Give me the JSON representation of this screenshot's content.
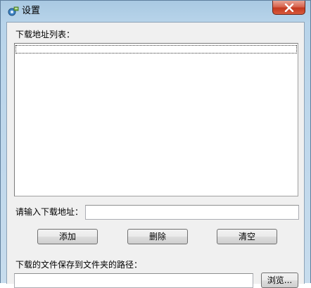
{
  "window": {
    "title": "设置",
    "icon": "settings-app-icon",
    "close_icon": "close-icon"
  },
  "list": {
    "label": "下载地址列表：",
    "items": []
  },
  "url_input": {
    "label": "请输入下载地址：",
    "value": "",
    "placeholder": ""
  },
  "buttons": {
    "add": "添加",
    "delete": "删除",
    "clear": "清空"
  },
  "save_path": {
    "label": "下载的文件保存到文件夹的路径：",
    "value": "",
    "browse": "浏览..."
  },
  "colors": {
    "titlebar": "#b8d4ea",
    "close_button": "#c3391f",
    "client_bg": "#f0f0f0"
  }
}
